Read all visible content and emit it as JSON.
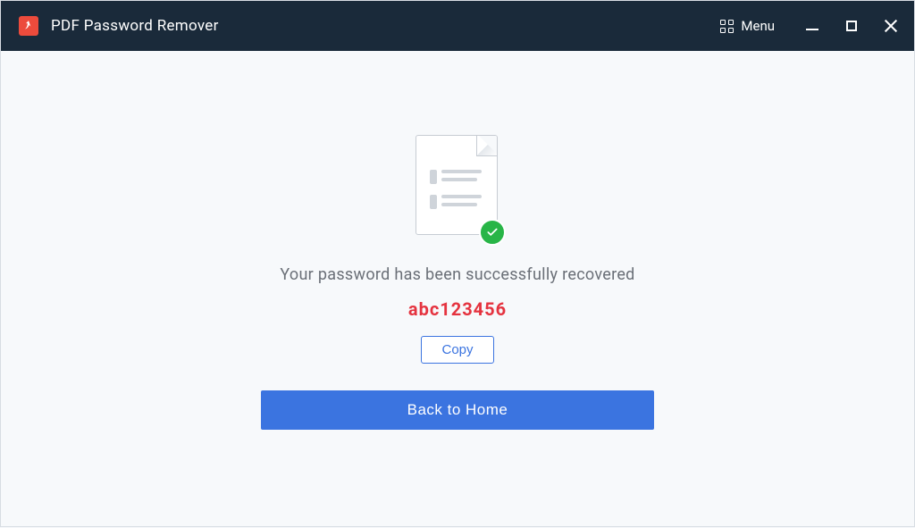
{
  "titlebar": {
    "app_title": "PDF Password Remover",
    "menu_label": "Menu"
  },
  "main": {
    "success_message": "Your password has been successfully recovered",
    "recovered_password": "abc123456",
    "copy_label": "Copy",
    "back_home_label": "Back to Home"
  },
  "colors": {
    "titlebar_bg": "#1a2a3a",
    "accent_red": "#e5333f",
    "primary_blue": "#3b74e0",
    "success_green": "#28b547",
    "app_icon_bg": "#ec4b3c"
  }
}
